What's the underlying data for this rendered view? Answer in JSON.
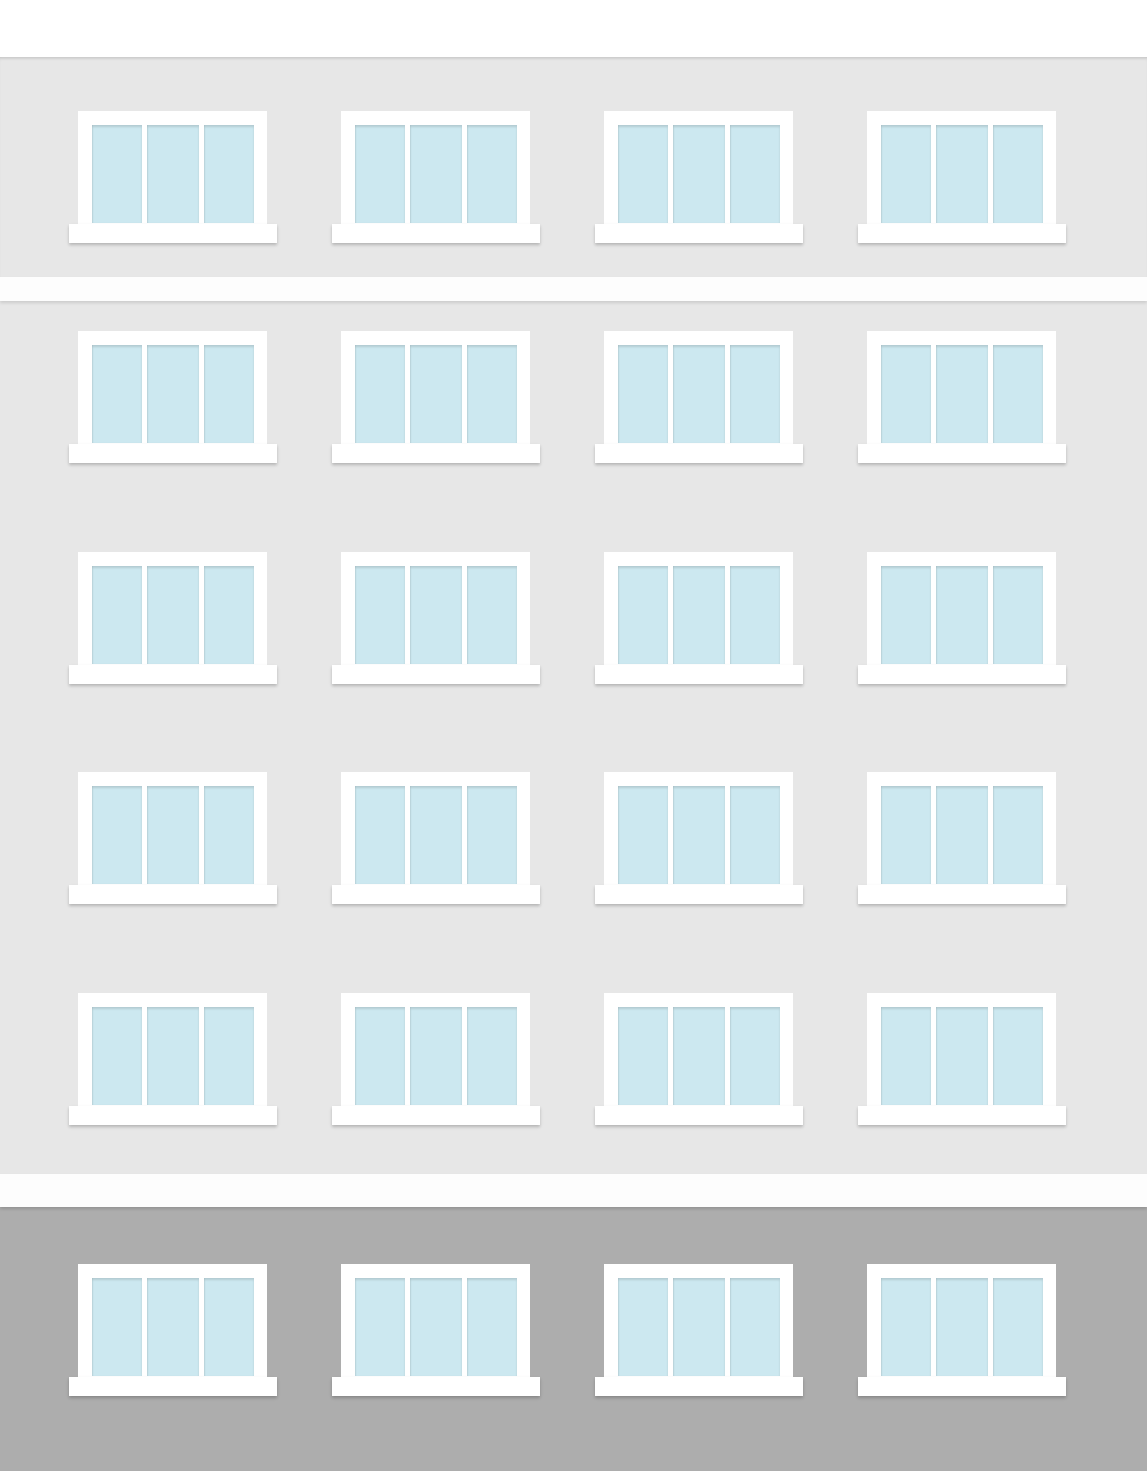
{
  "colors": {
    "sky": "#ffffff",
    "wall": "#e7e7e7",
    "ledge": "#fdfdfd",
    "ground_wall": "#adadad",
    "window_frame": "#ffffff",
    "glass": "#cce8f0"
  },
  "building": {
    "floors": 6,
    "windows_per_floor": 4,
    "panes_per_window": 3
  }
}
